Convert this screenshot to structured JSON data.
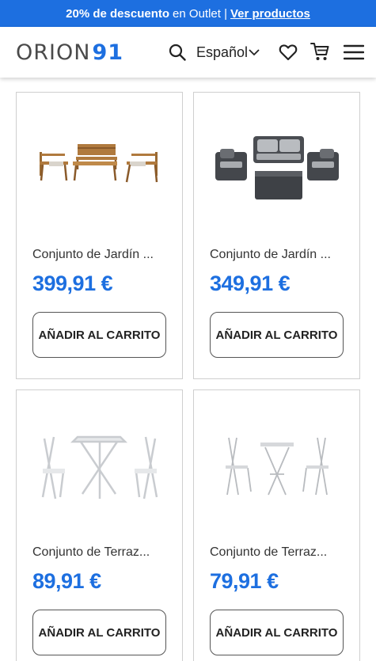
{
  "promo": {
    "bold_text": "20% de descuento",
    "text": "en Outlet |",
    "link": "Ver productos"
  },
  "header": {
    "logo_text": "ORION",
    "logo_number": "91",
    "language": "Español"
  },
  "colors": {
    "accent": "#1d6fe0",
    "promo_bg": "#1d6fe0"
  },
  "products": [
    {
      "name": "Conjunto de Jardín ...",
      "price": "399,91 €",
      "button": "AÑADIR AL CARRITO"
    },
    {
      "name": "Conjunto de Jardín ...",
      "price": "349,91 €",
      "button": "AÑADIR AL CARRITO"
    },
    {
      "name": "Conjunto de Terraz...",
      "price": "89,91 €",
      "button": "AÑADIR AL CARRITO"
    },
    {
      "name": "Conjunto de Terraz...",
      "price": "79,91 €",
      "button": "AÑADIR AL CARRITO"
    }
  ]
}
